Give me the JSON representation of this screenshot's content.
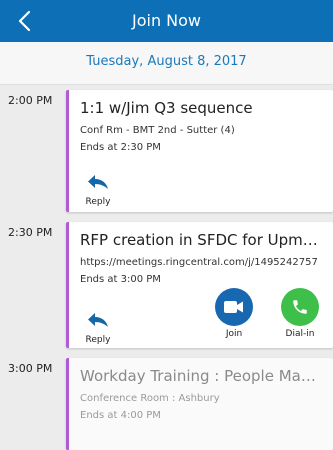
{
  "header": {
    "title": "Join Now"
  },
  "date": "Tuesday, August 8, 2017",
  "events": [
    {
      "time": "2:00 PM",
      "title": "1:1 w/Jim Q3 sequence",
      "location": "Conf Rm - BMT 2nd - Sutter (4)",
      "ends": "Ends at 2:30 PM",
      "reply_label": "Reply"
    },
    {
      "time": "2:30 PM",
      "title": "RFP creation in SFDC for Upmark...",
      "location": "https://meetings.ringcentral.com/j/1495242757",
      "ends": "Ends at 3:00 PM",
      "reply_label": "Reply",
      "join_label": "Join",
      "dialin_label": "Dial-in"
    },
    {
      "time": "3:00 PM",
      "title": "Workday Training : People Manag...",
      "location": "Conference Room : Ashbury",
      "ends": "Ends at 4:00 PM"
    }
  ],
  "colors": {
    "header": "#0d6fb5",
    "accent_bar": "#b15ad5",
    "join": "#1768b0",
    "dialin": "#3dbf4a",
    "reply_icon": "#1468a8"
  }
}
